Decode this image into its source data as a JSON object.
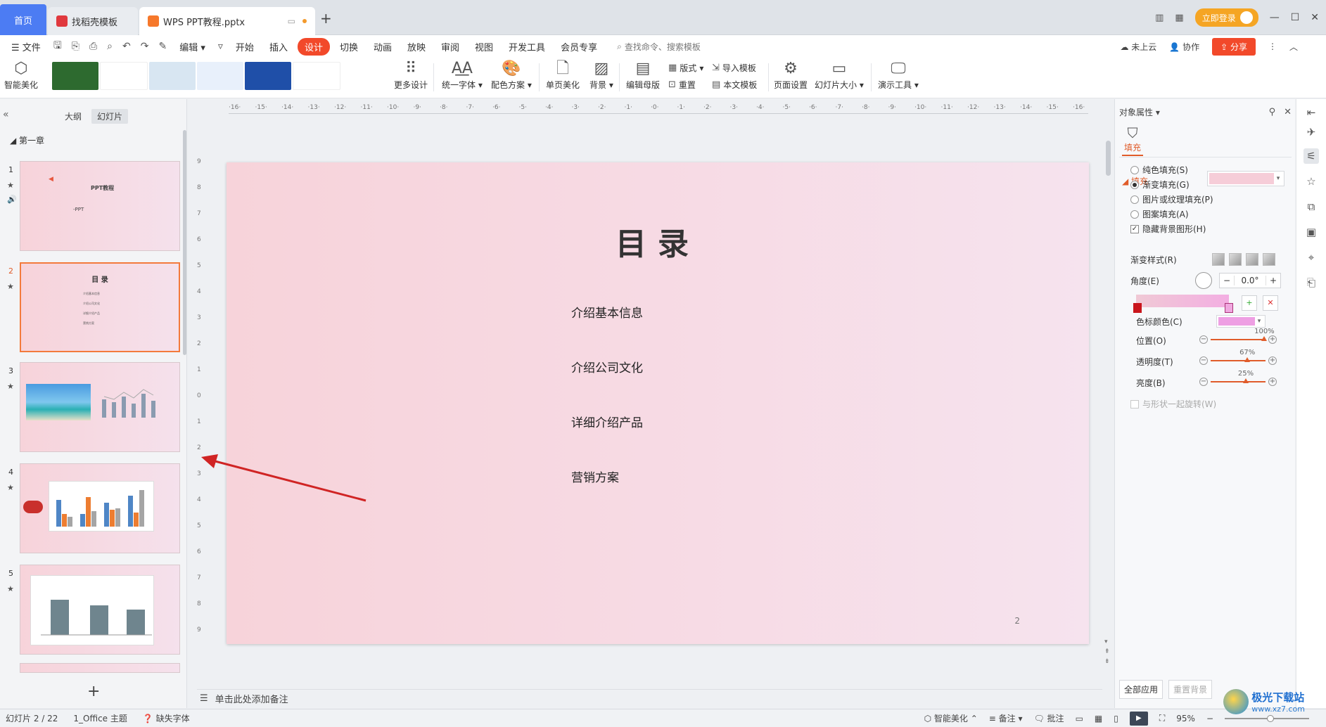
{
  "tabs": {
    "home": "首页",
    "template": "找稻壳模板",
    "document": "WPS PPT教程.pptx"
  },
  "top_right": {
    "login": "立即登录"
  },
  "menu": {
    "file": "文件",
    "edit": "编辑",
    "items": [
      "开始",
      "插入",
      "设计",
      "切换",
      "动画",
      "放映",
      "审阅",
      "视图",
      "开发工具",
      "会员专享"
    ],
    "active": "设计",
    "search_placeholder": "查找命令、搜索模板",
    "not_synced": "未上云",
    "collaborate": "协作",
    "share": "分享"
  },
  "ribbon": {
    "smart_beautify": "智能美化",
    "more_design": "更多设计",
    "unify_font": "统一字体",
    "color_scheme": "配色方案",
    "single_page_beautify": "单页美化",
    "background": "背景",
    "edit_master": "编辑母版",
    "layout": "版式",
    "reset": "重置",
    "import_template": "导入模板",
    "this_template": "本文模板",
    "page_setup": "页面设置",
    "slide_size": "幻灯片大小",
    "presentation_tools": "演示工具",
    "template_colors": [
      "#2d6a2f",
      "#ffffff",
      "#d8e6f2",
      "#e8f0fb",
      "#1f4fa8",
      "#ffffff",
      "#1a3a6b",
      "#f4f6fa"
    ]
  },
  "left_panel": {
    "tab_outline": "大纲",
    "tab_slides": "幻灯片",
    "chapter": "第一章",
    "slides": [
      {
        "num": "1",
        "title": "PPT教程",
        "sub": "-PPT"
      },
      {
        "num": "2",
        "title": "目 录",
        "lines": [
          "介绍基本信息",
          "介绍公司文化",
          "详细介绍产品",
          "营销方案"
        ]
      },
      {
        "num": "3"
      },
      {
        "num": "4"
      },
      {
        "num": "5"
      }
    ]
  },
  "slide": {
    "title": "目录",
    "items": [
      "介绍基本信息",
      "介绍公司文化",
      "详细介绍产品",
      "营销方案"
    ],
    "page_number": "2"
  },
  "notes_placeholder": "单击此处添加备注",
  "properties": {
    "header": "对象属性",
    "tab_fill": "填充",
    "section_fill": "填充",
    "options": {
      "solid": "纯色填充(S)",
      "gradient": "渐变填充(G)",
      "picture": "图片或纹理填充(P)",
      "pattern": "图案填充(A)",
      "hide_bg": "隐藏背景图形(H)"
    },
    "selected_option": "gradient",
    "gradient_style": "渐变样式(R)",
    "angle_label": "角度(E)",
    "angle_value": "0.0°",
    "stop_color": "色标颜色(C)",
    "position_label": "位置(O)",
    "position_value": "100%",
    "transparency_label": "透明度(T)",
    "transparency_value": "67%",
    "brightness_label": "亮度(B)",
    "brightness_value": "25%",
    "rotate_with_shape": "与形状一起旋转(W)",
    "apply_all": "全部应用",
    "reset_bg": "重置背景",
    "fill_color": "#f6cdd8",
    "stop_color_value": "#ee9fe3"
  },
  "status": {
    "slide_count": "幻灯片 2 / 22",
    "theme": "1_Office 主题",
    "missing_font": "缺失字体",
    "smart_beautify": "智能美化",
    "notes": "备注",
    "comments": "批注",
    "zoom": "95%"
  },
  "watermark": {
    "name": "极光下载站",
    "url": "www.xz7.com"
  }
}
